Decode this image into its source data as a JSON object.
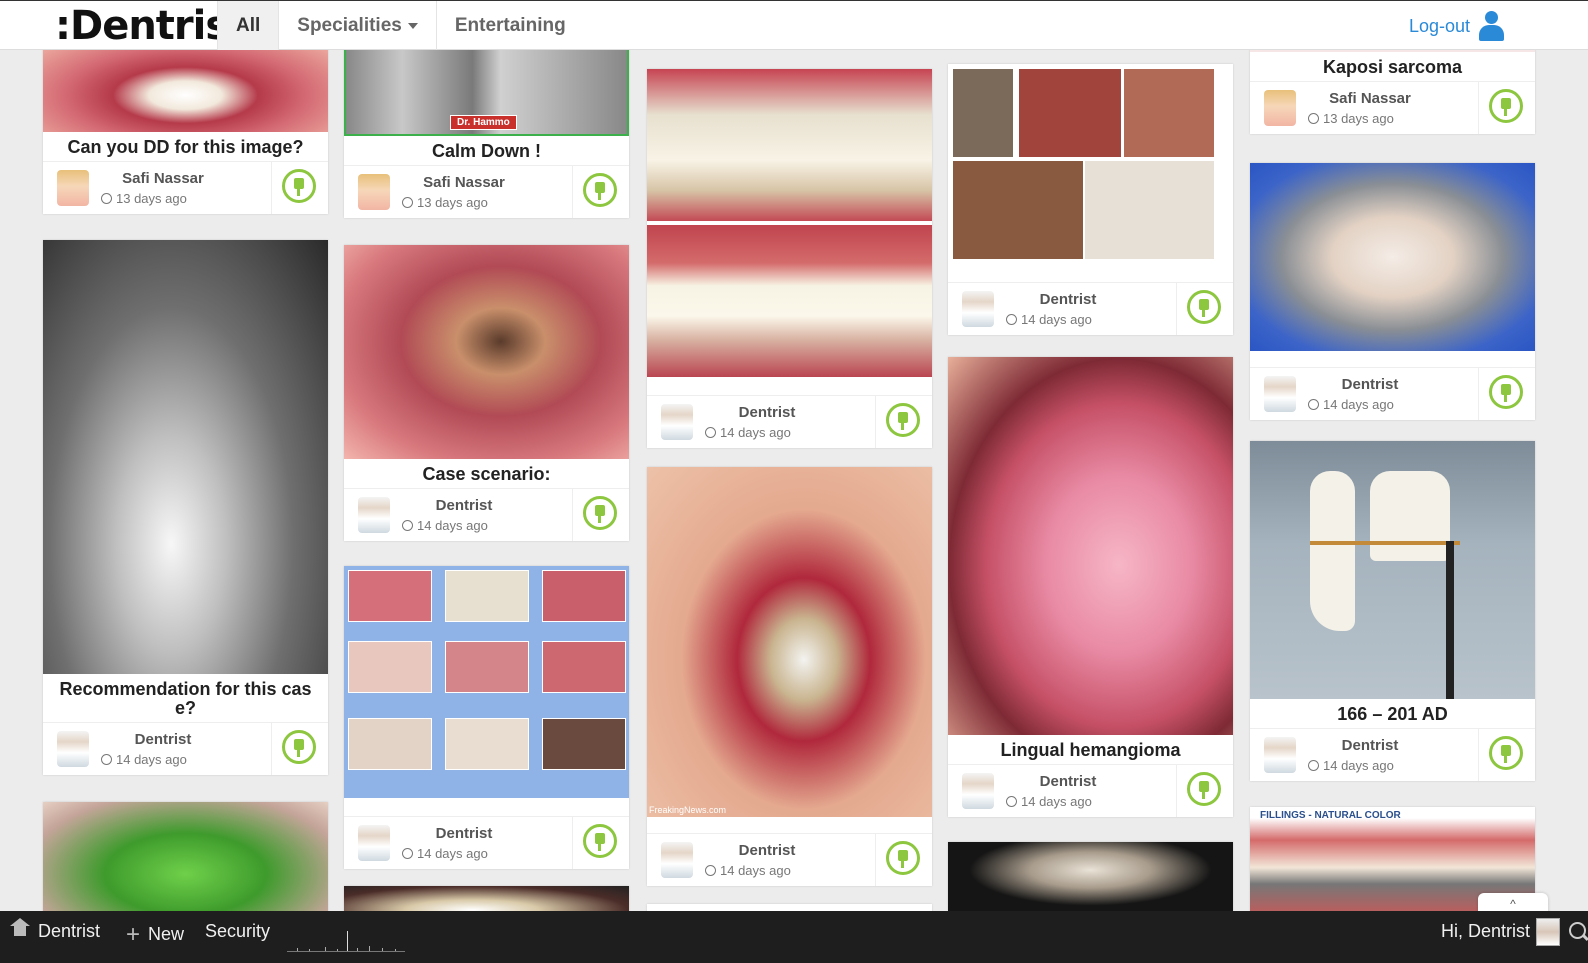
{
  "header": {
    "logo": ":Dentrist",
    "nav": [
      {
        "label": "All",
        "active": true
      },
      {
        "label": "Specialities",
        "dropdown": true
      },
      {
        "label": "Entertaining"
      }
    ],
    "logout": "Log-out"
  },
  "cards": [
    {
      "title": "Can you DD for this image?",
      "author": "Safi Nassar",
      "time": "13 days ago"
    },
    {
      "title": "Recommendation for this cas e?",
      "author": "Dentrist",
      "time": "14 days ago"
    },
    {
      "title": "Calm Down !",
      "tag": "Dr. Hammo",
      "author": "Safi Nassar",
      "time": "13 days ago"
    },
    {
      "title": "Case scenario:",
      "author": "Dentrist",
      "time": "14 days ago"
    },
    {
      "author": "Dentrist",
      "time": "14 days ago"
    },
    {
      "author": "Dentrist",
      "time": "14 days ago"
    },
    {
      "author": "Dentrist",
      "time": "14 days ago",
      "watermark": "FreakingNews.com"
    },
    {
      "author": "Dentrist",
      "time": "14 days ago"
    },
    {
      "title": "Lingual hemangioma",
      "author": "Dentrist",
      "time": "14 days ago"
    },
    {
      "title": "Kaposi sarcoma",
      "author": "Safi Nassar",
      "time": "13 days ago"
    },
    {
      "author": "Dentrist",
      "time": "14 days ago"
    },
    {
      "title": "166 – 201 AD",
      "author": "Dentrist",
      "time": "14 days ago"
    },
    {
      "label": "FILLINGS - NATURAL COLOR"
    }
  ],
  "bottombar": {
    "home": "Dentrist",
    "new": "New",
    "security": "Security",
    "greeting": "Hi, Dentrist"
  },
  "colors": {
    "accent": "#8dc63f",
    "link": "#2a8ad8",
    "bar": "#1e1e1e"
  }
}
